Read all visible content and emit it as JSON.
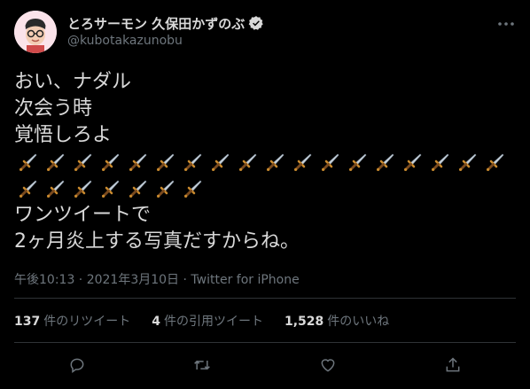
{
  "user": {
    "display_name": "とろサーモン 久保田かずのぶ",
    "handle": "@kubotakazunobu",
    "verified": true
  },
  "tweet": {
    "lines_before": [
      "おい、ナダル",
      "次会う時",
      "覚悟しろよ"
    ],
    "dagger_count": 25,
    "lines_after": [
      "ワンツイートで",
      "2ヶ月炎上する写真だすからね。"
    ]
  },
  "meta": {
    "text": "午後10:13 · 2021年3月10日 · Twitter for iPhone"
  },
  "stats": {
    "retweets_count": "137",
    "retweets_label": "件のリツイート",
    "quotes_count": "4",
    "quotes_label": "件の引用ツイート",
    "likes_count": "1,528",
    "likes_label": "件のいいね"
  },
  "colors": {
    "background": "#000000",
    "text": "#d9d9d9",
    "secondary": "#6e767d",
    "divider": "#2f3336"
  },
  "icons": {
    "more": "more-icon",
    "reply": "reply-icon",
    "retweet": "retweet-icon",
    "like": "like-icon",
    "share": "share-icon",
    "dagger": "dagger-icon"
  }
}
